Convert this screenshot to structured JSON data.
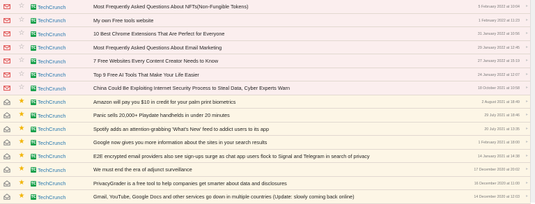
{
  "feed_list": {
    "items": [
      {
        "state": "unread",
        "icon": "envelope-icon",
        "starred": false,
        "feed": "TechCrunch",
        "title": "Most Frequently Asked Questions About NFTs(Non-Fungible Tokens)",
        "date": "5 February 2022 at 10:04"
      },
      {
        "state": "unread",
        "icon": "envelope-icon",
        "starred": false,
        "feed": "TechCrunch",
        "title": "My own Free tools website",
        "date": "1 February 2022 at 11:23"
      },
      {
        "state": "unread",
        "icon": "envelope-icon",
        "starred": false,
        "feed": "TechCrunch",
        "title": "10 Best Chrome Extensions That Are Perfect for Everyone",
        "date": "31 January 2022 at 10:56"
      },
      {
        "state": "unread",
        "icon": "envelope-icon",
        "starred": false,
        "feed": "TechCrunch",
        "title": "Most Frequently Asked Questions About Email Marketing",
        "date": "29 January 2022 at 12:45"
      },
      {
        "state": "unread",
        "icon": "envelope-icon",
        "starred": false,
        "feed": "TechCrunch",
        "title": "7 Free Websites Every Content Creator Needs to Know",
        "date": "27 January 2022 at 15:19"
      },
      {
        "state": "unread",
        "icon": "envelope-icon",
        "starred": false,
        "feed": "TechCrunch",
        "title": "Top 9 Free AI Tools That Make Your Life Easier",
        "date": "24 January 2022 at 12:07"
      },
      {
        "state": "unread",
        "icon": "envelope-icon",
        "starred": false,
        "feed": "TechCrunch",
        "title": "China Could Be Exploiting Internet Security Process to Steal Data, Cyber Experts Warn",
        "date": "18 October 2021 at 10:58"
      },
      {
        "state": "read",
        "icon": "open-envelope-icon",
        "starred": true,
        "feed": "TechCrunch",
        "title": "Amazon will pay you $10 in credit for your palm print biometrics",
        "date": "2 August 2021 at 18:49"
      },
      {
        "state": "read",
        "icon": "open-envelope-icon",
        "starred": true,
        "feed": "TechCrunch",
        "title": "Panic sells 20,000+ Playdate handhelds in under 20 minutes",
        "date": "29 July 2021 at 18:46"
      },
      {
        "state": "read",
        "icon": "open-envelope-icon",
        "starred": true,
        "feed": "TechCrunch",
        "title": "Spotify adds an attention-grabbing 'What's New' feed to addict users to its app",
        "date": "20 July 2021 at 13:35"
      },
      {
        "state": "read",
        "icon": "open-envelope-icon",
        "starred": true,
        "feed": "TechCrunch",
        "title": "Google now gives you more information about the sites in your search results",
        "date": "1 February 2021 at 18:00"
      },
      {
        "state": "read",
        "icon": "open-envelope-icon",
        "starred": true,
        "feed": "TechCrunch",
        "title": "E2E encrypted email providers also see sign-ups surge as chat app users flock to Signal and Telegram in search of privacy",
        "date": "14 January 2021 at 14:38"
      },
      {
        "state": "read",
        "icon": "open-envelope-icon",
        "starred": true,
        "feed": "TechCrunch",
        "title": "We must end the era of adjunct surveillance",
        "date": "17 December 2020 at 20:02"
      },
      {
        "state": "read",
        "icon": "open-envelope-icon",
        "starred": true,
        "feed": "TechCrunch",
        "title": "PrivacyGrader is a free tool to help companies get smarter about data and disclosures",
        "date": "16 December 2020 at 11:00"
      },
      {
        "state": "read",
        "icon": "open-envelope-icon",
        "starred": true,
        "feed": "TechCrunch",
        "title": "Gmail, YouTube, Google Docs and other services go down in multiple countries (Update: slowly coming back online)",
        "date": "14 December 2020 at 12:03"
      }
    ],
    "favicon_text": "TC"
  },
  "colors": {
    "unread_icon": "#e05555",
    "read_icon": "#8a8a8a",
    "star": "#f2b400",
    "feed_link": "#2a7ab0",
    "favicon": "#1aa14d"
  }
}
